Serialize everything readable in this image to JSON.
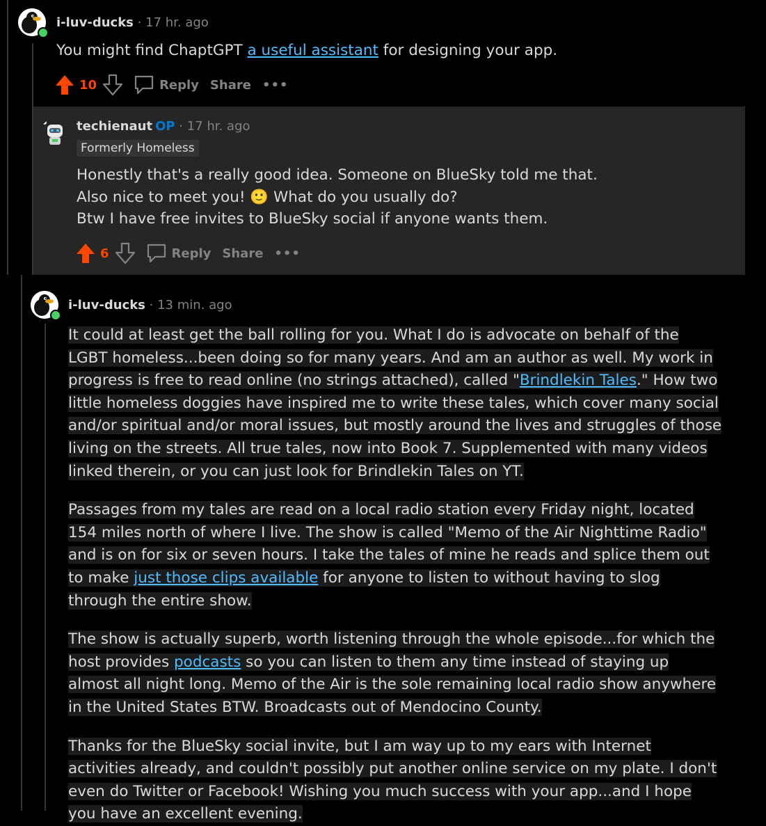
{
  "comment1": {
    "username": "i-luv-ducks",
    "time": "17 hr. ago",
    "text_before": "You might find ChaptGPT ",
    "link_text": "a useful assistant",
    "text_after": " for designing your app.",
    "votes": "10",
    "reply_label": "Reply",
    "share_label": "Share",
    "more_label": "•••"
  },
  "comment2": {
    "username": "techienaut",
    "op_badge": "OP",
    "time": "17 hr. ago",
    "flair": "Formerly Homeless",
    "line1": "Honestly that's a really good idea. Someone on BlueSky told me that.",
    "line2a": "Also nice to meet you! ",
    "emoji": "🙂",
    "line2b": " What do you usually do?",
    "line3": "Btw I have free invites to BlueSky social if anyone wants them.",
    "votes": "6",
    "reply_label": "Reply",
    "share_label": "Share",
    "more_label": "•••"
  },
  "comment3": {
    "username": "i-luv-ducks",
    "time": "13 min. ago",
    "p1_before": "It could at least get the ball rolling for you. What I do is advocate on behalf of the LGBT homeless...been doing so for many years. And am an author as well. My work in progress is free to read online (no strings attached), called \"",
    "p1_link": "Brindlekin Tales",
    "p1_after": ".\" How two little homeless doggies have inspired me to write these tales, which cover many social and/or spiritual and/or moral issues, but mostly around the lives and struggles of those living on the streets. All true tales, now into Book 7. Supplemented with many videos linked therein, or you can just look for Brindlekin Tales on YT.",
    "p2_before": "Passages from my tales are read on a local radio station every Friday night, located 154 miles north of where I live. The show is called \"Memo of the Air Nighttime Radio\" and is on for six or seven hours. I take the tales of mine he reads and splice them out to make ",
    "p2_link": "just those clips available",
    "p2_after": " for anyone to listen to without having to slog through the entire show.",
    "p3_before": "The show is actually superb, worth listening through the whole episode...for which the host provides ",
    "p3_link": "podcasts",
    "p3_after": " so you can listen to them any time instead of staying up almost all night long. Memo of the Air is the sole remaining local radio show anywhere in the United States BTW. Broadcasts out of Mendocino County.",
    "p4": "Thanks for the BlueSky social invite, but I am way up to my ears with Internet activities already, and couldn't possibly put another online service on my plate. I don't even do Twitter or Facebook! Wishing you much success with your app...and I hope you have an excellent evening."
  },
  "separator": "·",
  "colors": {
    "upvote": "#ff4500",
    "link": "#4fbcff",
    "op": "#0079d3",
    "online": "#46d160"
  }
}
